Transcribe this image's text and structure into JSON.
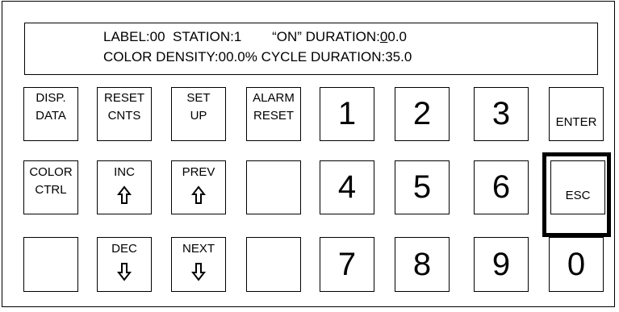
{
  "display": {
    "line1_a": "LABEL:00  STATION:1        “ON” DURATION:",
    "line1_b": "0",
    "line1_c": "0.0",
    "line2": "COLOR DENSITY:00.0% CYCLE DURATION:35.0"
  },
  "keys": {
    "disp_data": [
      "DISP.",
      "DATA"
    ],
    "reset_cnts": [
      "RESET",
      "CNTS"
    ],
    "set_up": [
      "SET",
      "UP"
    ],
    "alarm_reset": [
      "ALARM",
      "RESET"
    ],
    "color_ctrl": [
      "COLOR",
      "CTRL"
    ],
    "inc": "INC",
    "prev": "PREV",
    "dec": "DEC",
    "next": "NEXT",
    "enter": "ENTER",
    "esc": "ESC",
    "digits": [
      "1",
      "2",
      "3",
      "4",
      "5",
      "6",
      "7",
      "8",
      "9",
      "0"
    ]
  },
  "icons": {
    "up": "up-arrow-icon",
    "down": "down-arrow-icon"
  },
  "selected_key": "ESC"
}
